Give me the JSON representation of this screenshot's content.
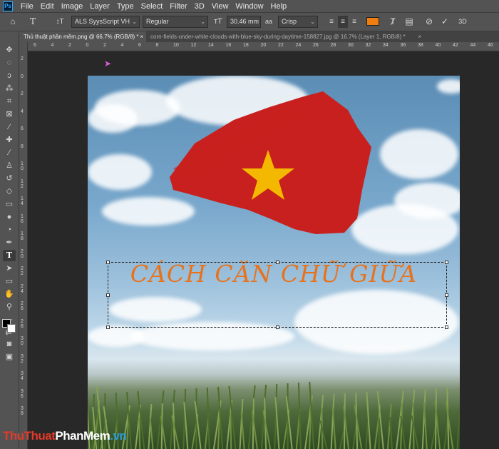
{
  "app": {
    "logo": "Ps"
  },
  "menu": [
    "File",
    "Edit",
    "Image",
    "Layer",
    "Type",
    "Select",
    "Filter",
    "3D",
    "View",
    "Window",
    "Help"
  ],
  "options": {
    "font_family": "ALS SyysScript VH",
    "font_style": "Regular",
    "font_size": "30.46 mm",
    "antialias_label": "aa",
    "antialias": "Crisp",
    "text_color": "#f07d10"
  },
  "tabs": [
    {
      "label": "Thủ thuật phần mềm.png @ 66.7% (RGB/8) *",
      "close": "×"
    },
    {
      "label": "corn-fields-under-white-clouds-with-blue-sky-during-daytime-158827.jpg @ 16.7% (Layer 1, RGB/8) *",
      "close": "×"
    }
  ],
  "ruler_h": [
    "6",
    "4",
    "2",
    "0",
    "2",
    "4",
    "6",
    "8",
    "10",
    "12",
    "14",
    "16",
    "18",
    "20",
    "22",
    "24",
    "26",
    "28",
    "30",
    "32",
    "34",
    "36",
    "38",
    "40",
    "42",
    "44",
    "46"
  ],
  "ruler_v": [
    "2",
    "0",
    "2",
    "4",
    "6",
    "8",
    "1 0",
    "1 2",
    "1 4",
    "1 6",
    "1 8",
    "2 0",
    "2 2",
    "2 4",
    "2 6",
    "2 8",
    "3 0",
    "3 2",
    "3 4",
    "3 6",
    "3 8"
  ],
  "canvas": {
    "text": "CÁCH CĂN CHỮ GIỮA",
    "text_color": "#e8721c",
    "flag_red": "#c8201e",
    "star_color": "#f5b800"
  },
  "watermark": {
    "part1": "ThuThuat",
    "part2": "PhanMem",
    "part3": ".vn"
  }
}
